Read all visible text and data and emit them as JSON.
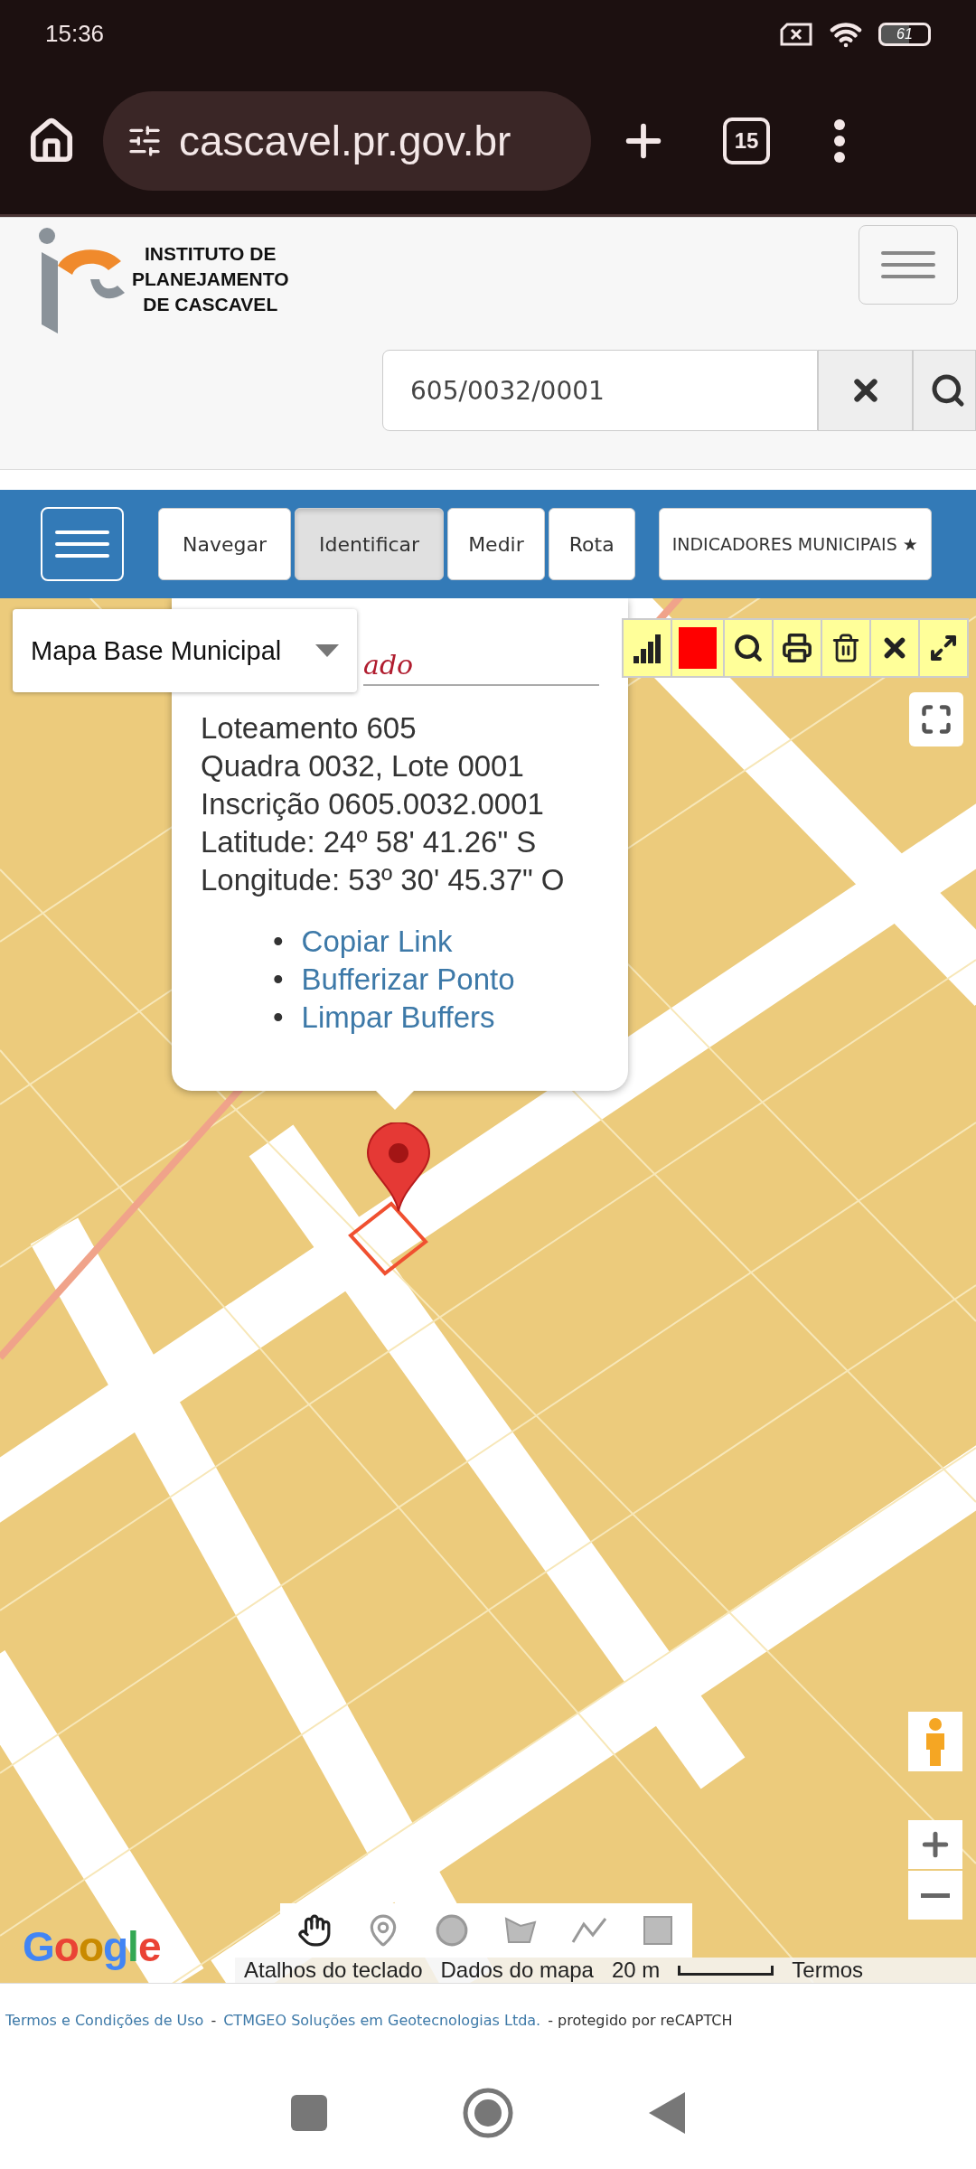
{
  "status_bar": {
    "time": "15:36",
    "battery": "61"
  },
  "browser": {
    "url": "cascavel.pr.gov.br",
    "tab_count": "15"
  },
  "header": {
    "logo_lines": [
      "INSTITUTO DE",
      "PLANEJAMENTO",
      "DE CASCAVEL"
    ]
  },
  "search": {
    "value": "605/0032/0001"
  },
  "tabs": [
    {
      "label": "Navegar",
      "selected": false
    },
    {
      "label": "Identificar",
      "selected": true
    },
    {
      "label": "Medir",
      "selected": false
    },
    {
      "label": "Rota",
      "selected": false
    },
    {
      "label": "INDICADORES MUNICIPAIS ★",
      "selected": false
    }
  ],
  "map": {
    "layer_select": "Mapa Base Municipal",
    "popup": {
      "title": "ado",
      "lines": [
        "Loteamento 605",
        "Quadra 0032, Lote 0001",
        "Inscrição 0605.0032.0001",
        "Latitude: 24º 58' 41.26\" S",
        "Longitude: 53º 30' 45.37\" O"
      ],
      "links": [
        {
          "marker": "•",
          "text": "Copiar Link"
        },
        {
          "marker": "•",
          "text": "Bufferizar Ponto"
        },
        {
          "marker": "•",
          "text": "Limpar Buffers"
        }
      ]
    },
    "logo": "Google",
    "attribution": [
      "Atalhos do teclado",
      "Dados do mapa"
    ],
    "scale": "20 m",
    "terms": "Termos"
  },
  "footer": [
    {
      "kind": "link",
      "text": "Termos e Condições de Uso"
    },
    {
      "kind": "text",
      "text": "-"
    },
    {
      "kind": "link",
      "text": "CTMGEO Soluções em Geotecnologias Ltda."
    },
    {
      "kind": "text",
      "text": "- protegido por reCAPTCH"
    }
  ]
}
